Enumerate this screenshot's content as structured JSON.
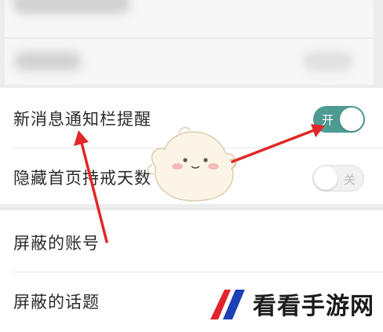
{
  "settings": {
    "notification_bar_reminder": {
      "label": "新消息通知栏提醒",
      "toggle_text": "开",
      "toggle_on": true
    },
    "hide_home_days": {
      "label": "隐藏首页持戒天数",
      "toggle_text": "关",
      "toggle_on": false
    },
    "blocked_accounts": {
      "label": "屏蔽的账号"
    },
    "blocked_topics": {
      "label": "屏蔽的话题"
    }
  },
  "colors": {
    "toggle_on": "#4e9b93",
    "annotation_arrow": "#e02828",
    "page_background": "#ececec"
  },
  "watermark": {
    "text": "看看手游网"
  }
}
